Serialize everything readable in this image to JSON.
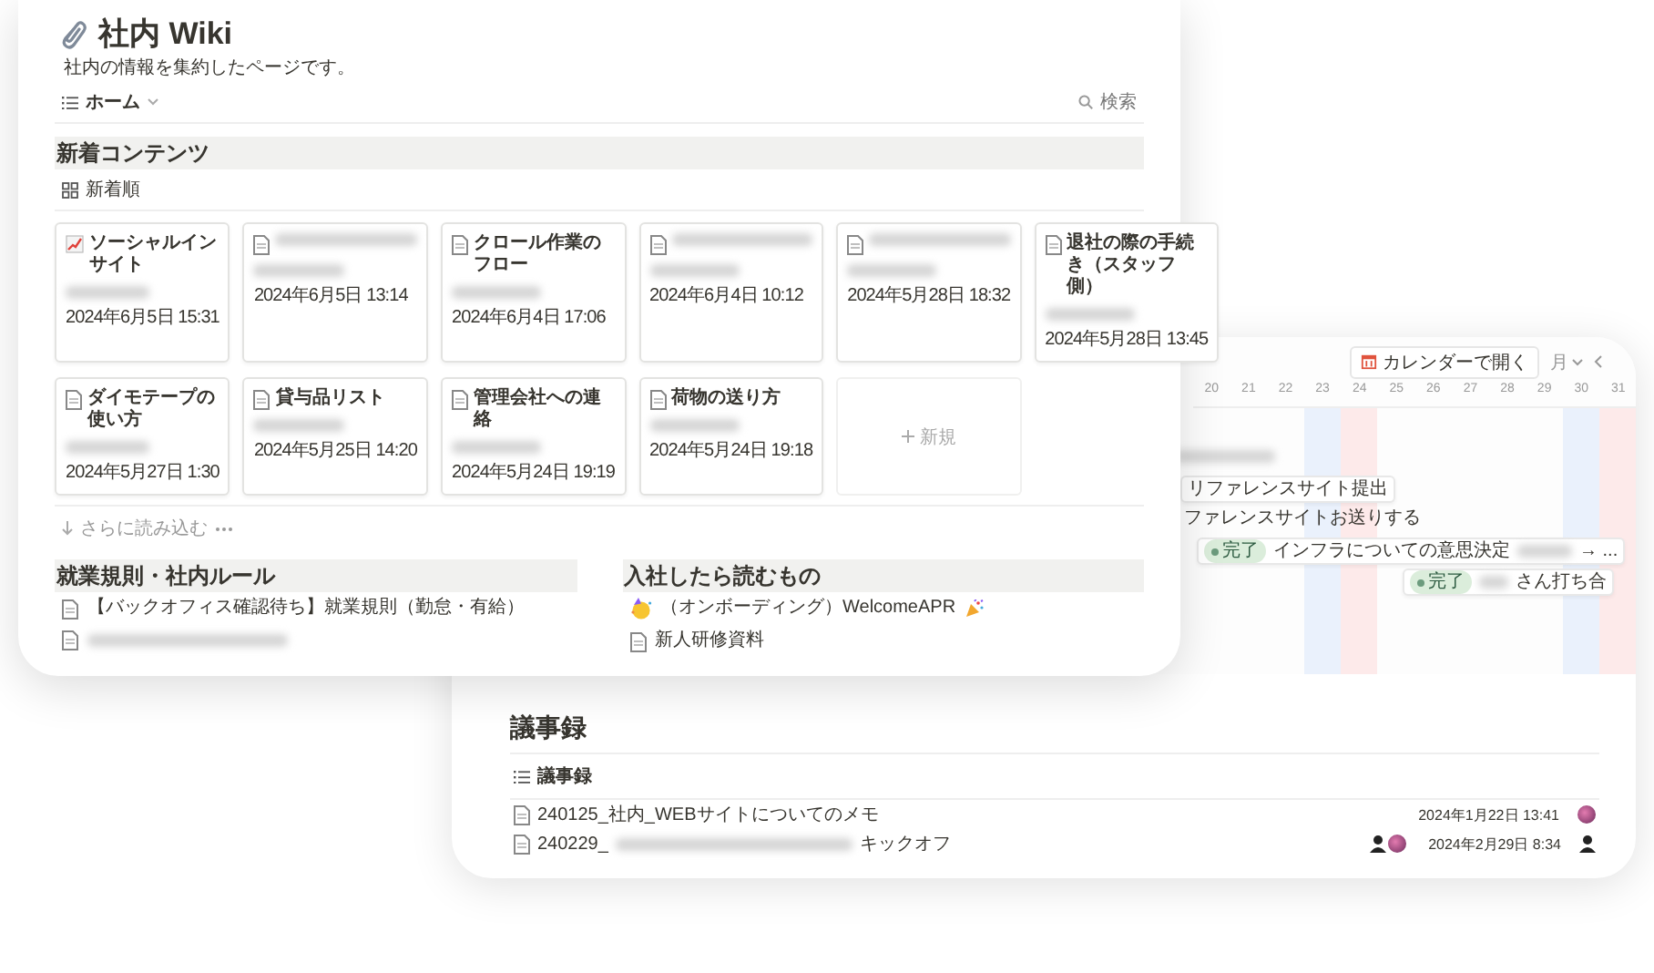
{
  "page": {
    "title": "社内 Wiki",
    "description": "社内の情報を集約したページです。",
    "nav": {
      "label": "ホーム",
      "search": "検索"
    }
  },
  "new_contents": {
    "title": "新着コンテンツ",
    "view": "新着順",
    "load_more": "さらに読み込む",
    "cards": [
      {
        "kind": "chart",
        "title": "ソーシャルインサイト",
        "date": "2024年6月5日 15:31"
      },
      {
        "kind": "page",
        "date": "2024年6月5日 13:14"
      },
      {
        "kind": "page",
        "title": "クロール作業のフロー",
        "date": "2024年6月4日 17:06"
      },
      {
        "kind": "page",
        "date": "2024年6月4日 10:12"
      },
      {
        "kind": "page",
        "date": "2024年5月28日 18:32"
      },
      {
        "kind": "page",
        "title": "退社の際の手続き（スタッフ側）",
        "date": "2024年5月28日 13:45"
      },
      {
        "kind": "page",
        "title": "ダイモテープの使い方",
        "date": "2024年5月27日 1:30"
      },
      {
        "kind": "page",
        "title": "貸与品リスト",
        "date": "2024年5月25日 14:20"
      },
      {
        "kind": "page",
        "title": "管理会社への連絡",
        "date": "2024年5月24日 19:19"
      },
      {
        "kind": "page",
        "title": "荷物の送り方",
        "date": "2024年5月24日 19:18"
      },
      {
        "kind": "new",
        "label": "新規"
      }
    ]
  },
  "sections": [
    {
      "title": "就業規則・社内ルール",
      "items": [
        {
          "kind": "page",
          "title": "【バックオフィス確認待ち】就業規則（勤怠・有給）"
        },
        {
          "kind": "page"
        }
      ]
    },
    {
      "title": "入社したら読むもの",
      "items": [
        {
          "kind": "party",
          "title": "（オンボーディング）WelcomeAPR"
        },
        {
          "kind": "page",
          "title": "新人研修資料"
        }
      ]
    }
  ],
  "calendar": {
    "open_button": "カレンダーで開く",
    "view": "月",
    "days": [
      {
        "label": "20",
        "kind": "weekday"
      },
      {
        "label": "21",
        "kind": "weekday"
      },
      {
        "label": "22",
        "kind": "weekday"
      },
      {
        "label": "23",
        "kind": "saturday"
      },
      {
        "label": "24",
        "kind": "sunday"
      },
      {
        "label": "25",
        "kind": "weekday"
      },
      {
        "label": "26",
        "kind": "weekday"
      },
      {
        "label": "27",
        "kind": "weekday"
      },
      {
        "label": "28",
        "kind": "weekday"
      },
      {
        "label": "29",
        "kind": "weekday"
      },
      {
        "label": "30",
        "kind": "saturday"
      },
      {
        "label": "31",
        "kind": "sunday"
      }
    ],
    "events": [
      {
        "kind": "blurred"
      },
      {
        "kind": "boxed",
        "title": "リファレンスサイト提出"
      },
      {
        "kind": "plain",
        "title": "ファレンスサイトお送りする"
      },
      {
        "kind": "task",
        "status": "完了",
        "title": "インフラについての意思決定",
        "trail": "→ ..."
      },
      {
        "kind": "meeting",
        "status": "完了",
        "title": "さん打ち合"
      }
    ]
  },
  "minutes": {
    "title": "議事録",
    "view": "議事録",
    "rows": [
      {
        "title_parts": [
          "240125_社内_WEBサイトについてのメモ"
        ],
        "date": "2024年1月22日 13:41"
      },
      {
        "title_parts": [
          "240229_",
          "キックオフ"
        ],
        "date": "2024年2月29日 8:34"
      }
    ]
  }
}
